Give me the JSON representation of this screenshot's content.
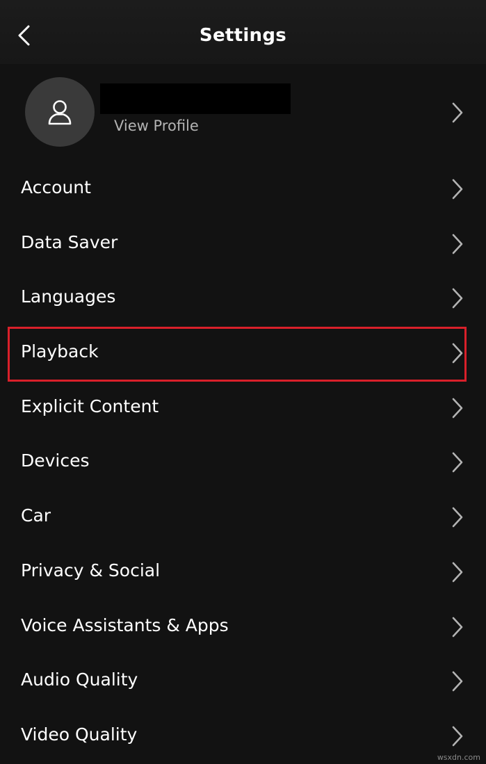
{
  "header": {
    "title": "Settings",
    "back_icon": "chevron-left-icon"
  },
  "profile": {
    "avatar_icon": "user-icon",
    "link_label": "View Profile"
  },
  "menu": {
    "items": [
      {
        "label": "Account"
      },
      {
        "label": "Data Saver"
      },
      {
        "label": "Languages"
      },
      {
        "label": "Playback"
      },
      {
        "label": "Explicit Content"
      },
      {
        "label": "Devices"
      },
      {
        "label": "Car"
      },
      {
        "label": "Privacy & Social"
      },
      {
        "label": "Voice Assistants & Apps"
      },
      {
        "label": "Audio Quality"
      },
      {
        "label": "Video Quality"
      }
    ],
    "highlighted": "Playback"
  },
  "colors": {
    "background": "#121212",
    "header": "#1a1a1a",
    "text": "#ffffff",
    "secondary_text": "#b3b3b3",
    "avatar": "#3a3a3a",
    "highlight_border": "#d9202a"
  },
  "watermark": "wsxdn.com"
}
